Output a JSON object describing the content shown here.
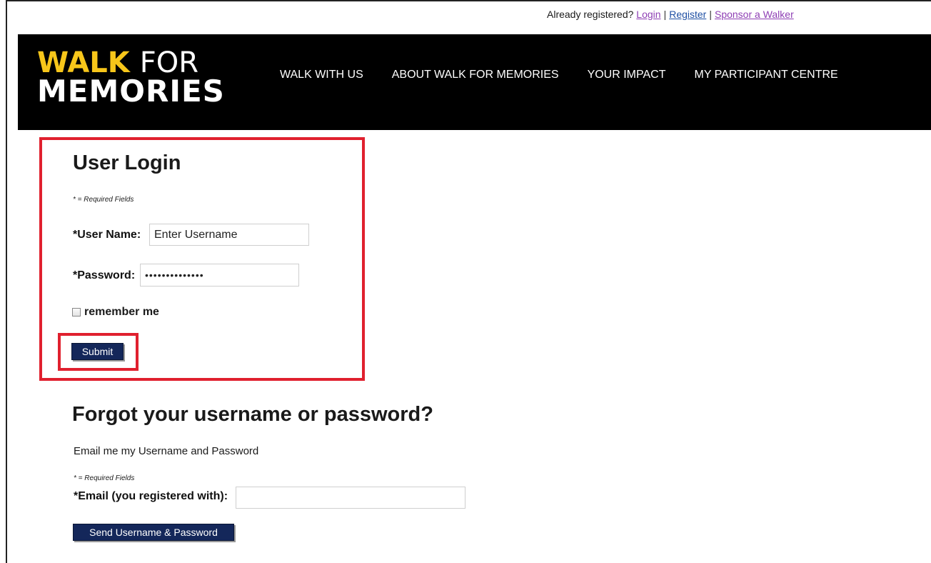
{
  "utility_bar": {
    "prompt": "Already registered?",
    "login": "Login",
    "separator": "|",
    "register": "Register",
    "sponsor": "Sponsor a Walker"
  },
  "logo": {
    "walk": "WALK",
    "for": "FOR",
    "memories": "MEMORIES"
  },
  "nav": {
    "items": [
      "WALK WITH US",
      "ABOUT WALK FOR MEMORIES",
      "YOUR IMPACT",
      "MY PARTICIPANT CENTRE"
    ]
  },
  "login": {
    "title": "User Login",
    "required_note": "* = Required Fields",
    "username_label": "*User Name:",
    "username_value": "Enter Username",
    "password_label": "*Password:",
    "password_value": "••••••••••••••",
    "remember_label": "remember me",
    "remember_checked": false,
    "submit_label": "Submit"
  },
  "forgot": {
    "title": "Forgot your username or password?",
    "description": "Email me my Username and Password",
    "required_note": "* = Required Fields",
    "email_label": "*Email (you registered with):",
    "email_value": "",
    "send_label": "Send Username & Password"
  },
  "colors": {
    "brand_yellow": "#f7c61a",
    "header_bg": "#000000",
    "button_navy": "#14275a",
    "highlight_red": "#e0202e",
    "visited_link": "#8e3fb4",
    "link_blue": "#1e4fa3"
  }
}
